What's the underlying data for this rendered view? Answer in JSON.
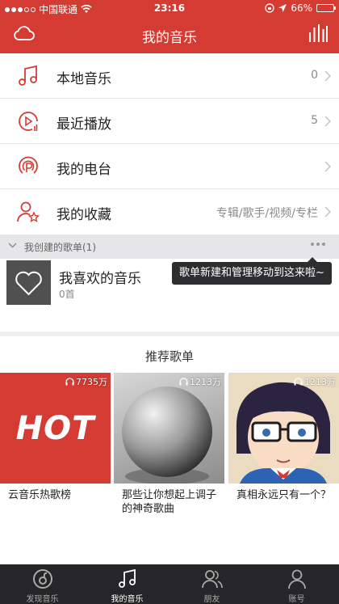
{
  "status": {
    "carrier": "中国联通",
    "time": "23:16",
    "battery": "66%",
    "battery_level": 0.66
  },
  "header": {
    "title": "我的音乐"
  },
  "menu": [
    {
      "label": "本地音乐",
      "value": "0",
      "icon": "music-note-icon"
    },
    {
      "label": "最近播放",
      "value": "5",
      "icon": "recent-play-icon"
    },
    {
      "label": "我的电台",
      "value": "",
      "icon": "radio-icon"
    },
    {
      "label": "我的收藏",
      "value": "专辑/歌手/视频/专栏",
      "icon": "favorite-user-star-icon"
    }
  ],
  "created_section": {
    "title": "我创建的歌单(1)"
  },
  "playlist": {
    "name": "我喜欢的音乐",
    "count": "0首"
  },
  "tooltip": "歌单新建和管理移动到这来啦~",
  "recommend": {
    "heading": "推荐歌单",
    "cards": [
      {
        "plays": "7735万",
        "caption": "云音乐热歌榜",
        "cover_text": "HOT"
      },
      {
        "plays": "1213万",
        "caption": "那些让你想起上调子的神奇歌曲"
      },
      {
        "plays": "1213万",
        "caption": "真相永远只有一个？"
      }
    ]
  },
  "tabs": [
    {
      "label": "发现音乐",
      "icon": "netease-logo-icon"
    },
    {
      "label": "我的音乐",
      "icon": "music-note-icon",
      "active": true
    },
    {
      "label": "朋友",
      "icon": "friends-icon"
    },
    {
      "label": "账号",
      "icon": "account-icon"
    }
  ],
  "colors": {
    "brand": "#d43c33",
    "tabbar": "#262628"
  }
}
